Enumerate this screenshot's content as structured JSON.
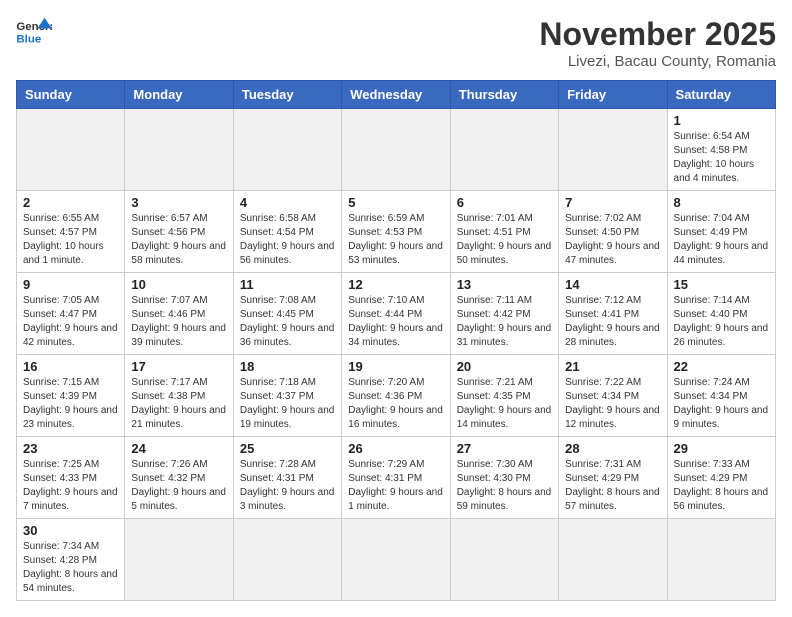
{
  "logo": {
    "text_general": "General",
    "text_blue": "Blue"
  },
  "title": "November 2025",
  "subtitle": "Livezi, Bacau County, Romania",
  "days_of_week": [
    "Sunday",
    "Monday",
    "Tuesday",
    "Wednesday",
    "Thursday",
    "Friday",
    "Saturday"
  ],
  "weeks": [
    [
      {
        "day": null,
        "info": null
      },
      {
        "day": null,
        "info": null
      },
      {
        "day": null,
        "info": null
      },
      {
        "day": null,
        "info": null
      },
      {
        "day": null,
        "info": null
      },
      {
        "day": null,
        "info": null
      },
      {
        "day": "1",
        "info": "Sunrise: 6:54 AM\nSunset: 4:58 PM\nDaylight: 10 hours and 4 minutes."
      }
    ],
    [
      {
        "day": "2",
        "info": "Sunrise: 6:55 AM\nSunset: 4:57 PM\nDaylight: 10 hours and 1 minute."
      },
      {
        "day": "3",
        "info": "Sunrise: 6:57 AM\nSunset: 4:56 PM\nDaylight: 9 hours and 58 minutes."
      },
      {
        "day": "4",
        "info": "Sunrise: 6:58 AM\nSunset: 4:54 PM\nDaylight: 9 hours and 56 minutes."
      },
      {
        "day": "5",
        "info": "Sunrise: 6:59 AM\nSunset: 4:53 PM\nDaylight: 9 hours and 53 minutes."
      },
      {
        "day": "6",
        "info": "Sunrise: 7:01 AM\nSunset: 4:51 PM\nDaylight: 9 hours and 50 minutes."
      },
      {
        "day": "7",
        "info": "Sunrise: 7:02 AM\nSunset: 4:50 PM\nDaylight: 9 hours and 47 minutes."
      },
      {
        "day": "8",
        "info": "Sunrise: 7:04 AM\nSunset: 4:49 PM\nDaylight: 9 hours and 44 minutes."
      }
    ],
    [
      {
        "day": "9",
        "info": "Sunrise: 7:05 AM\nSunset: 4:47 PM\nDaylight: 9 hours and 42 minutes."
      },
      {
        "day": "10",
        "info": "Sunrise: 7:07 AM\nSunset: 4:46 PM\nDaylight: 9 hours and 39 minutes."
      },
      {
        "day": "11",
        "info": "Sunrise: 7:08 AM\nSunset: 4:45 PM\nDaylight: 9 hours and 36 minutes."
      },
      {
        "day": "12",
        "info": "Sunrise: 7:10 AM\nSunset: 4:44 PM\nDaylight: 9 hours and 34 minutes."
      },
      {
        "day": "13",
        "info": "Sunrise: 7:11 AM\nSunset: 4:42 PM\nDaylight: 9 hours and 31 minutes."
      },
      {
        "day": "14",
        "info": "Sunrise: 7:12 AM\nSunset: 4:41 PM\nDaylight: 9 hours and 28 minutes."
      },
      {
        "day": "15",
        "info": "Sunrise: 7:14 AM\nSunset: 4:40 PM\nDaylight: 9 hours and 26 minutes."
      }
    ],
    [
      {
        "day": "16",
        "info": "Sunrise: 7:15 AM\nSunset: 4:39 PM\nDaylight: 9 hours and 23 minutes."
      },
      {
        "day": "17",
        "info": "Sunrise: 7:17 AM\nSunset: 4:38 PM\nDaylight: 9 hours and 21 minutes."
      },
      {
        "day": "18",
        "info": "Sunrise: 7:18 AM\nSunset: 4:37 PM\nDaylight: 9 hours and 19 minutes."
      },
      {
        "day": "19",
        "info": "Sunrise: 7:20 AM\nSunset: 4:36 PM\nDaylight: 9 hours and 16 minutes."
      },
      {
        "day": "20",
        "info": "Sunrise: 7:21 AM\nSunset: 4:35 PM\nDaylight: 9 hours and 14 minutes."
      },
      {
        "day": "21",
        "info": "Sunrise: 7:22 AM\nSunset: 4:34 PM\nDaylight: 9 hours and 12 minutes."
      },
      {
        "day": "22",
        "info": "Sunrise: 7:24 AM\nSunset: 4:34 PM\nDaylight: 9 hours and 9 minutes."
      }
    ],
    [
      {
        "day": "23",
        "info": "Sunrise: 7:25 AM\nSunset: 4:33 PM\nDaylight: 9 hours and 7 minutes."
      },
      {
        "day": "24",
        "info": "Sunrise: 7:26 AM\nSunset: 4:32 PM\nDaylight: 9 hours and 5 minutes."
      },
      {
        "day": "25",
        "info": "Sunrise: 7:28 AM\nSunset: 4:31 PM\nDaylight: 9 hours and 3 minutes."
      },
      {
        "day": "26",
        "info": "Sunrise: 7:29 AM\nSunset: 4:31 PM\nDaylight: 9 hours and 1 minute."
      },
      {
        "day": "27",
        "info": "Sunrise: 7:30 AM\nSunset: 4:30 PM\nDaylight: 8 hours and 59 minutes."
      },
      {
        "day": "28",
        "info": "Sunrise: 7:31 AM\nSunset: 4:29 PM\nDaylight: 8 hours and 57 minutes."
      },
      {
        "day": "29",
        "info": "Sunrise: 7:33 AM\nSunset: 4:29 PM\nDaylight: 8 hours and 56 minutes."
      }
    ],
    [
      {
        "day": "30",
        "info": "Sunrise: 7:34 AM\nSunset: 4:28 PM\nDaylight: 8 hours and 54 minutes."
      },
      {
        "day": null,
        "info": null
      },
      {
        "day": null,
        "info": null
      },
      {
        "day": null,
        "info": null
      },
      {
        "day": null,
        "info": null
      },
      {
        "day": null,
        "info": null
      },
      {
        "day": null,
        "info": null
      }
    ]
  ]
}
